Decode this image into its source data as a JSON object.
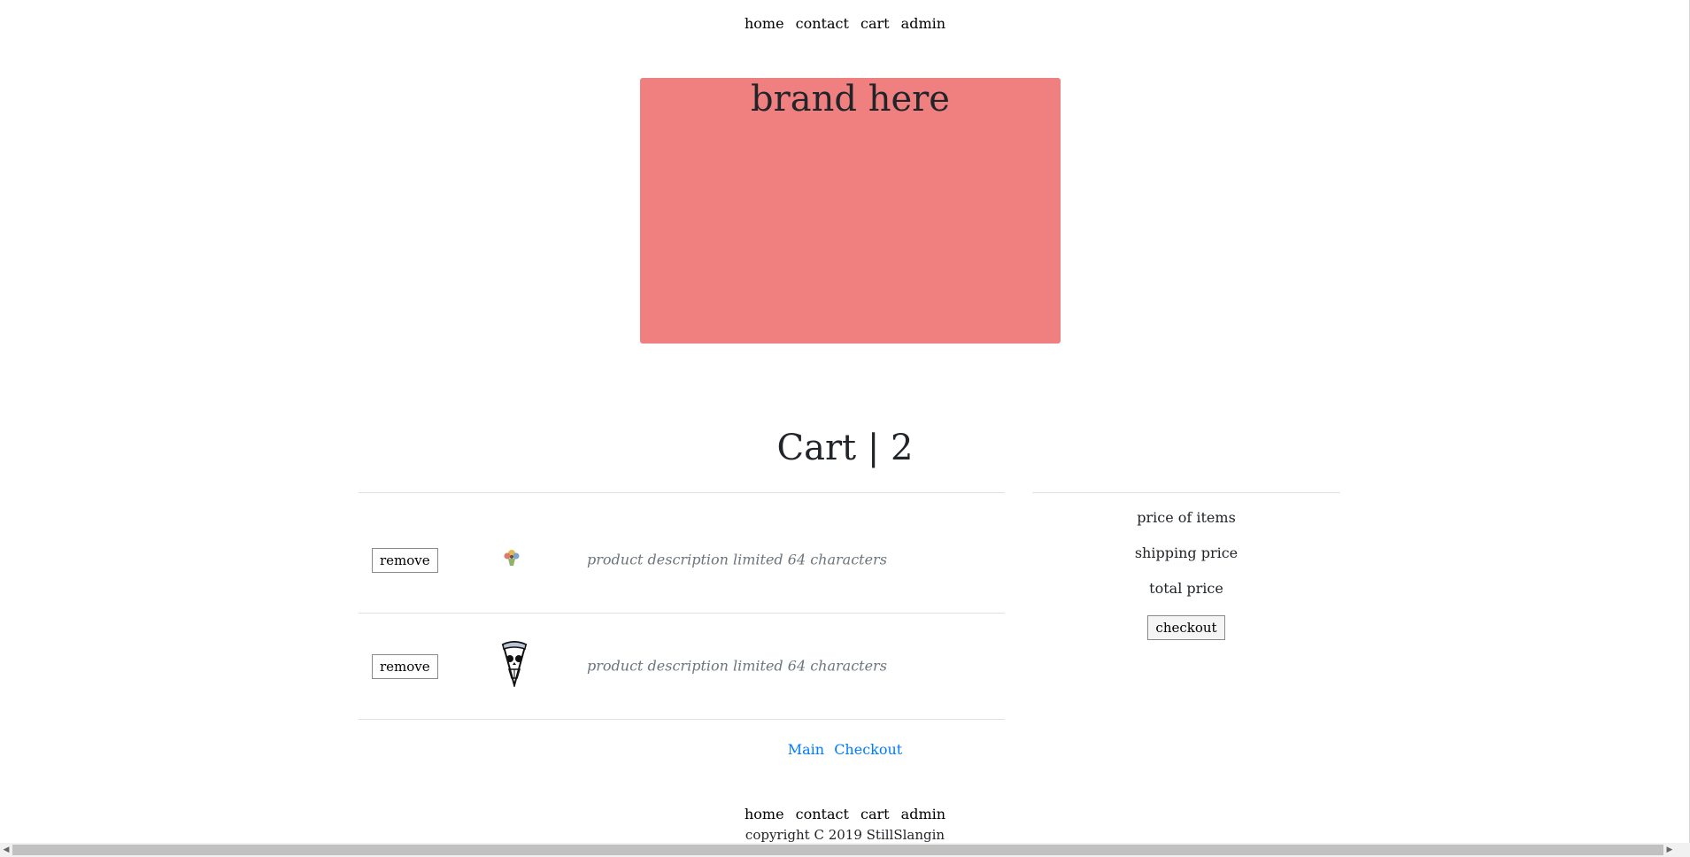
{
  "nav": {
    "items": [
      "home",
      "contact",
      "cart",
      "admin"
    ]
  },
  "brand": {
    "text": "brand here",
    "color": "#f08080"
  },
  "cart": {
    "title": "Cart | 2",
    "items": [
      {
        "remove_label": "remove",
        "image_icon": "flower-sticker-icon",
        "description": "product description limited 64 characters"
      },
      {
        "remove_label": "remove",
        "image_icon": "skull-pizza-icon",
        "description": "product description limited 64 characters"
      }
    ]
  },
  "summary": {
    "price_of_items": "price of items",
    "shipping_price": "shipping price",
    "total_price": "total price",
    "checkout_label": "checkout"
  },
  "bottom_links": {
    "main": "Main",
    "checkout": "Checkout",
    "color": "#007bff"
  },
  "footer": {
    "nav": [
      "home",
      "contact",
      "cart",
      "admin"
    ],
    "copyright": "copyright C 2019 StillSlangin"
  }
}
